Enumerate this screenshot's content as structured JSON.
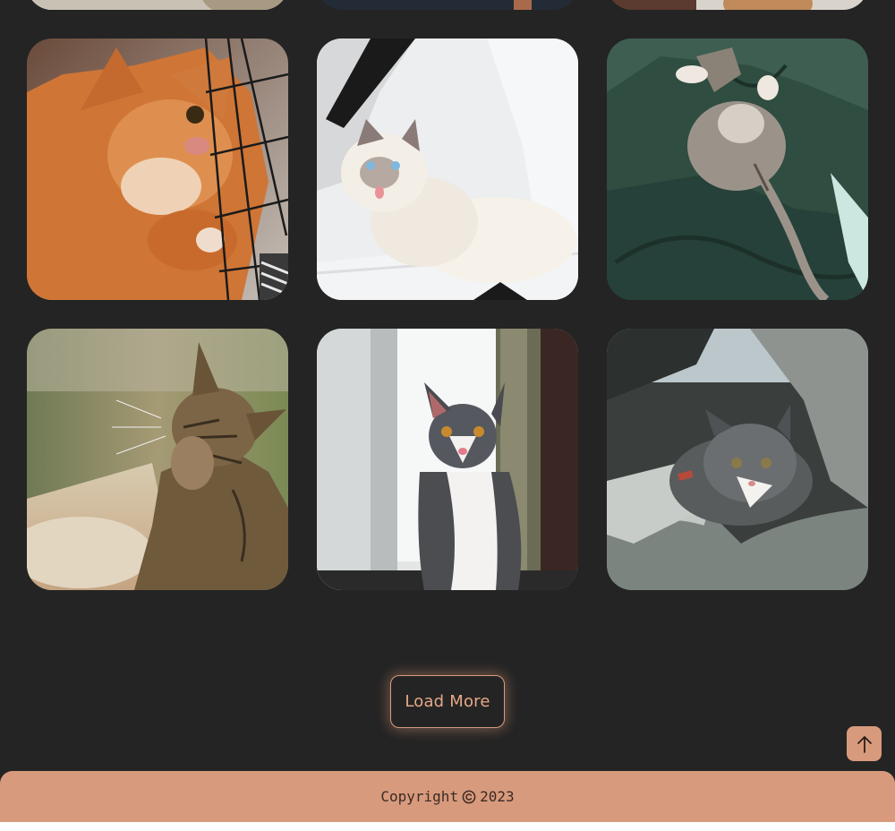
{
  "accent_color": "#d89a7d",
  "background_color": "#242424",
  "gallery": {
    "photos": [
      {
        "subject": "cat photo"
      },
      {
        "subject": "cat photo"
      },
      {
        "subject": "cat photo"
      },
      {
        "subject": "orange tabby cat pawing at a net"
      },
      {
        "subject": "white fluffy cat with blue eyes on a white chair"
      },
      {
        "subject": "grey tabby cat sleeping on a green leather couch"
      },
      {
        "subject": "tabby cat scratching in the sunlight"
      },
      {
        "subject": "grey and white cat sitting by a window"
      },
      {
        "subject": "grey and white cat lying in a fleece bed"
      }
    ]
  },
  "load_more": {
    "label": "Load More"
  },
  "back_to_top": {
    "icon": "arrow-up-icon"
  },
  "footer": {
    "copyright_label": "Copyright",
    "copyright_icon": "copyright-icon",
    "year": "2023"
  }
}
